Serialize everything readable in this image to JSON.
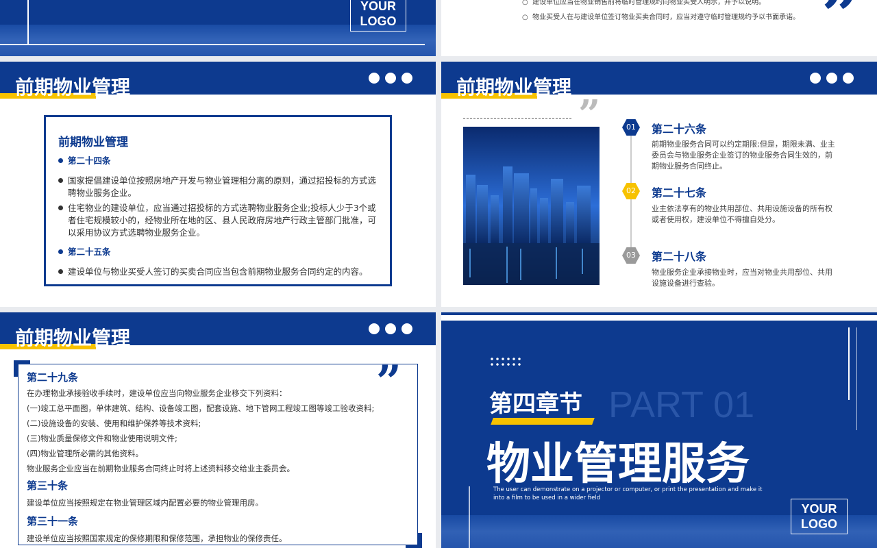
{
  "top_left": {
    "logo_line1": "YOUR",
    "logo_line2": "LOGO"
  },
  "top_right": {
    "line1": "建设单位应当在物业销售前将临时管理规约向物业买受人明示，并予以说明。",
    "line2": "物业买受人在与建设单位签订物业买卖合同时，应当对遵守临时管理规约予以书面承诺。"
  },
  "slide1": {
    "title": "前期物业管理",
    "box_title": "前期物业管理",
    "items": [
      {
        "text": "第二十四条",
        "kind": "heading"
      },
      {
        "text": "国家提倡建设单位按照房地产开发与物业管理相分离的原则，通过招投标的方式选聘物业服务企业。",
        "kind": "body"
      },
      {
        "text": "住宅物业的建设单位，应当通过招投标的方式选聘物业服务企业;投标人少于3个或者住宅规模较小的，经物业所在地的区、县人民政府房地产行政主管部门批准，可以采用协议方式选聘物业服务企业。",
        "kind": "body"
      },
      {
        "text": "第二十五条",
        "kind": "heading"
      },
      {
        "text": "建设单位与物业买受人签订的买卖合同应当包含前期物业服务合同约定的内容。",
        "kind": "body"
      }
    ]
  },
  "slide2": {
    "title": "前期物业管理",
    "items": [
      {
        "num": "01",
        "title": "第二十六条",
        "desc": "前期物业服务合同可以约定期限;但是，期限未满、业主委员会与物业服务企业签订的物业服务合同生效的，前期物业服务合同终止。",
        "color": "#0d3a8f"
      },
      {
        "num": "02",
        "title": "第二十七条",
        "desc": "业主依法享有的物业共用部位、共用设施设备的所有权或者使用权，建设单位不得擅自处分。",
        "color": "#f7c200"
      },
      {
        "num": "03",
        "title": "第二十八条",
        "desc": "物业服务企业承接物业时，应当对物业共用部位、共用设施设备进行查验。",
        "color": "#9a9a9a"
      }
    ]
  },
  "slide3": {
    "title": "前期物业管理",
    "t1": "第二十九条",
    "lines": [
      "在办理物业承接验收手续时，建设单位应当向物业服务企业移交下列资料：",
      "(一)竣工总平面图，单体建筑、结构、设备竣工图，配套设施、地下管网工程竣工图等竣工验收资料;",
      "(二)设施设备的安装、使用和维护保养等技术资料;",
      "(三)物业质量保修文件和物业使用说明文件;",
      "(四)物业管理所必需的其他资料。",
      "物业服务企业应当在前期物业服务合同终止时将上述资料移交给业主委员会。"
    ],
    "t2": "第三十条",
    "l2": "建设单位应当按照规定在物业管理区域内配置必要的物业管理用房。",
    "t3": "第三十一条",
    "l3": "建设单位应当按照国家规定的保修期限和保修范围，承担物业的保修责任。"
  },
  "slide4": {
    "chapter": "第四章节",
    "part": "PART 01",
    "title": "物业管理服务",
    "sub1": "The user can demonstrate on a projector or computer, or print the presentation and make it",
    "sub2": "into a film to be used in a wider field",
    "logo_line1": "YOUR",
    "logo_line2": "LOGO"
  },
  "colors": {
    "navy": "#0d3a8f",
    "accent": "#f7c200",
    "gray": "#9a9a9a"
  },
  "icons": {
    "quote": "quote-icon",
    "dots": "dots-icon"
  }
}
